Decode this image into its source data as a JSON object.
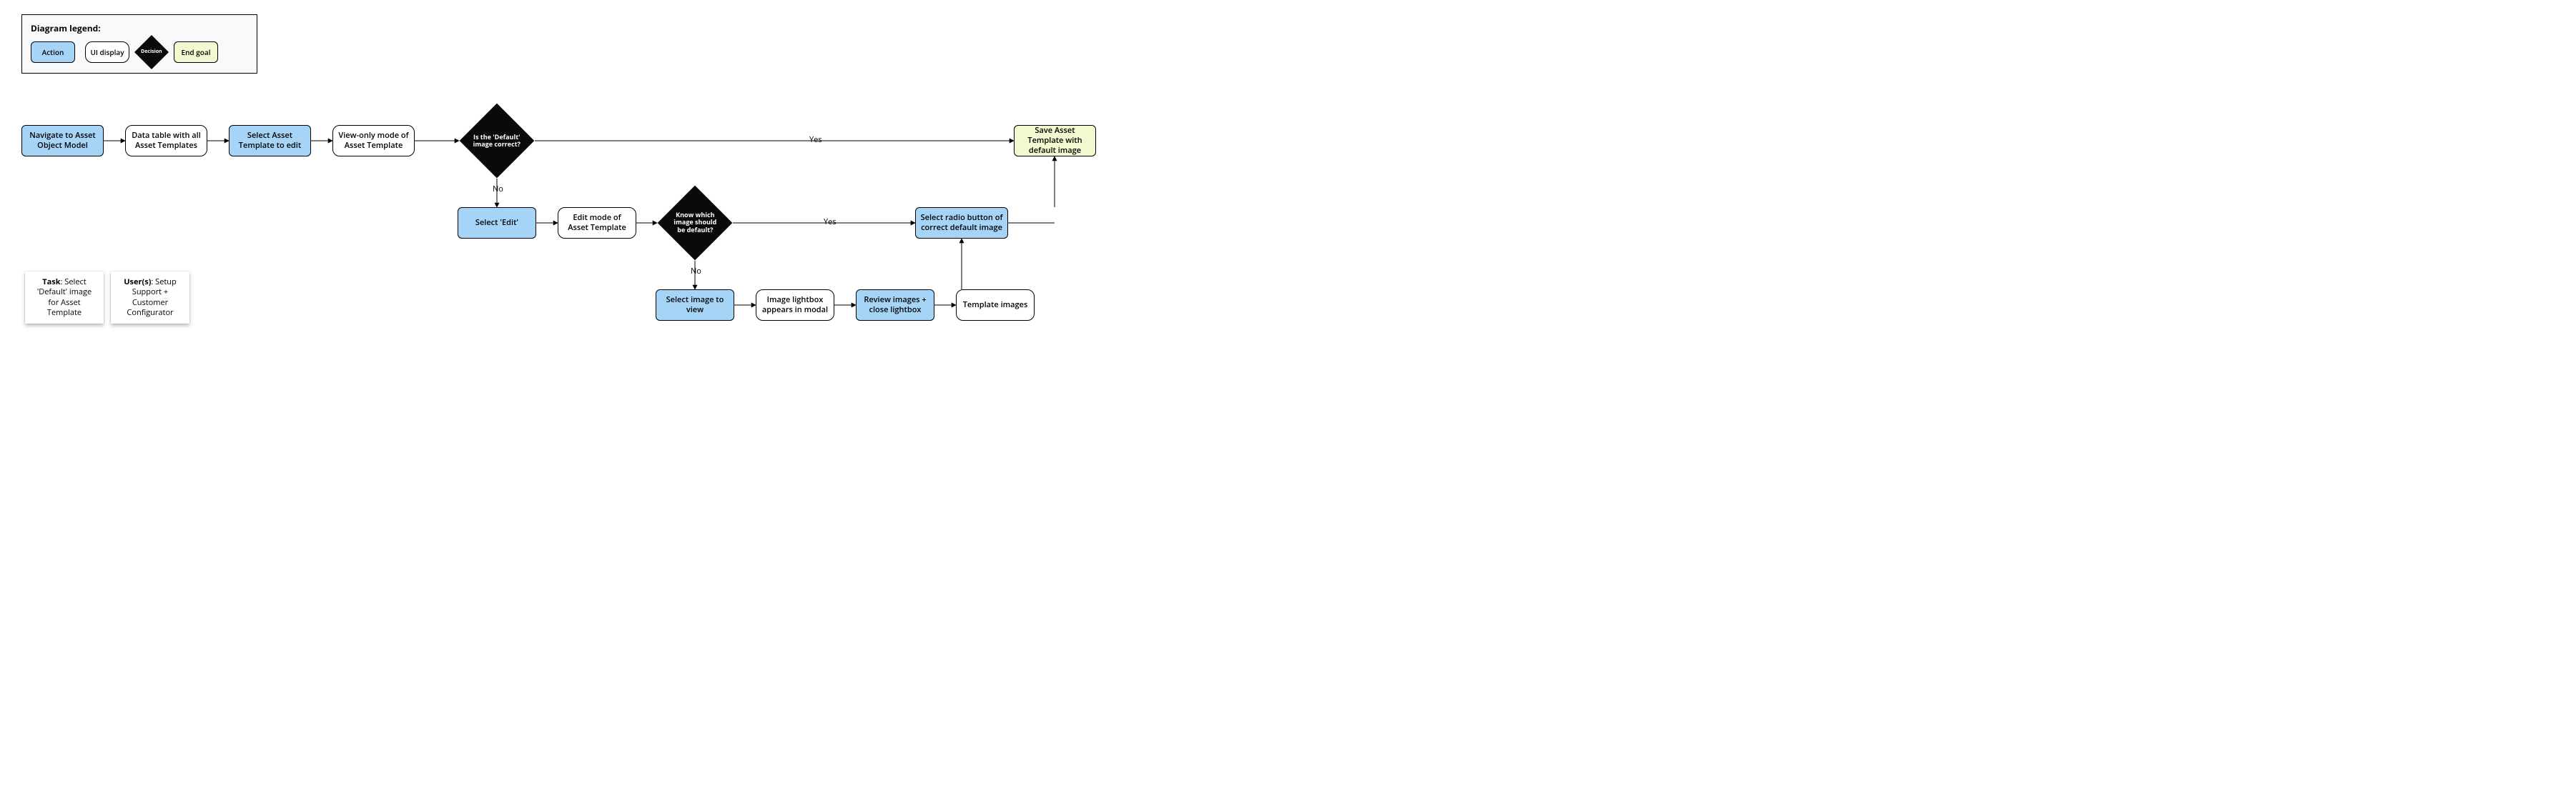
{
  "legend": {
    "title": "Diagram legend:",
    "action": "Action",
    "display": "UI display",
    "decision": "Decision",
    "endgoal": "End goal"
  },
  "nodes": {
    "nav": "Navigate to Asset Object Model",
    "datatable": "Data table with all Asset Templates",
    "selectEdit": "Select Asset Template to edit",
    "viewOnly": "View-only mode of Asset Template",
    "decDefault": "Is the 'Default' image correct?",
    "save": "Save Asset Template with default image",
    "selectEditBtn": "Select 'Edit'",
    "editMode": "Edit mode of Asset Template",
    "decKnow": "Know which image should be default?",
    "selectRadio": "Select radio button of correct default image",
    "selectImg": "Select image to view",
    "lightbox": "Image lightbox appears in modal",
    "review": "Review images + close lightbox",
    "tmplImages": "Template images"
  },
  "edgeLabels": {
    "yes1": "Yes",
    "no1": "No",
    "yes2": "Yes",
    "no2": "No"
  },
  "notes": {
    "task": {
      "label": "Task",
      "text": ": Select 'Default' image for Asset Template"
    },
    "users": {
      "label": "User(s)",
      "text": ": Setup Support + Customer Configurator"
    }
  }
}
